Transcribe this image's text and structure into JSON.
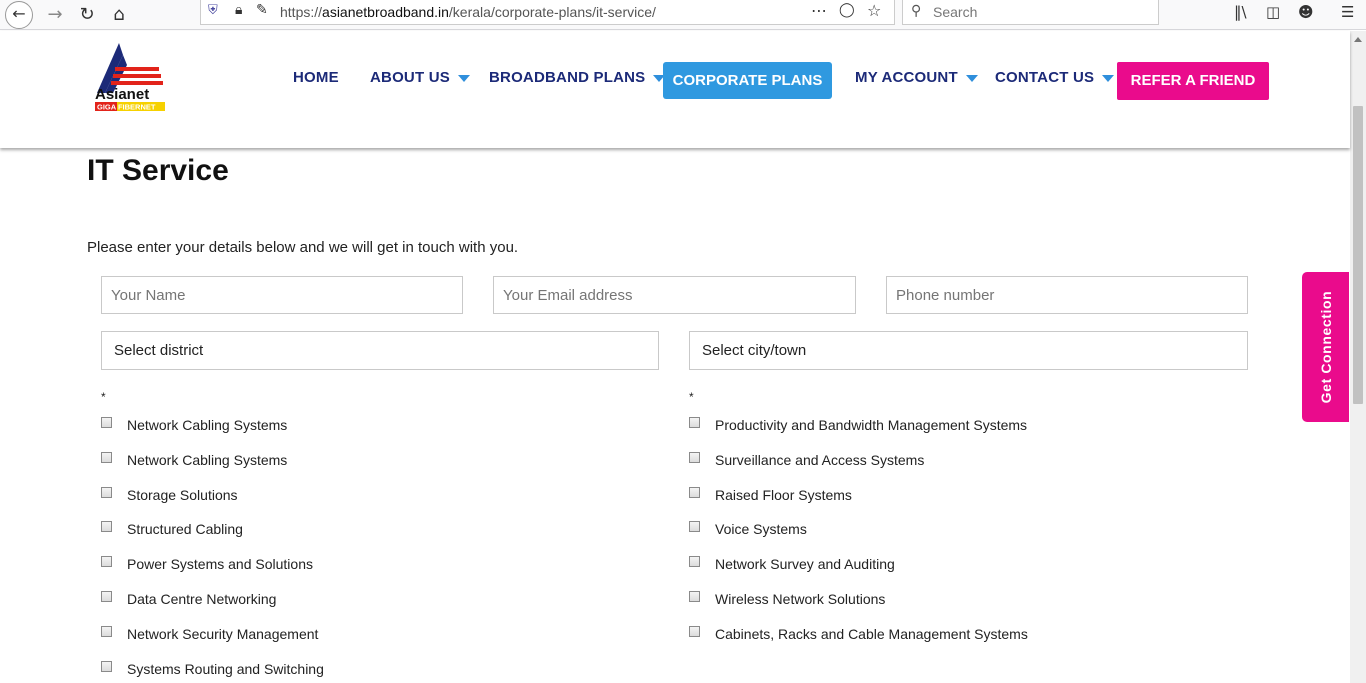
{
  "browser": {
    "url_prefix": "https://",
    "url_domain": "asianetbroadband.in",
    "url_path": "/kerala/corporate-plans/it-service/",
    "search_placeholder": "Search",
    "icons": [
      "back-icon",
      "forward-icon",
      "reload-icon",
      "home-icon",
      "shield-icon",
      "lock-icon",
      "permissions-icon",
      "more-icon",
      "pocket-icon",
      "bookmark-star-icon",
      "search-icon",
      "library-icon",
      "sidebar-icon",
      "account-icon",
      "menu-icon"
    ]
  },
  "header": {
    "logo_text": "Asianet",
    "logo_sub": "GIGA FIBERNET",
    "nav": {
      "home": "HOME",
      "about": "ABOUT US",
      "broadband": "BROADBAND PLANS",
      "corporate": "CORPORATE PLANS",
      "account": "MY ACCOUNT",
      "contact": "CONTACT US",
      "refer": "REFER A FRIEND"
    },
    "colors": {
      "nav_text": "#1c2a78",
      "active_bg": "#2f99e0",
      "accent_pink": "#ea0b8c"
    }
  },
  "page": {
    "title": "IT Service",
    "intro": "Please enter your details below and we will get in touch with you."
  },
  "form": {
    "name_placeholder": "Your Name",
    "email_placeholder": "Your Email address",
    "phone_placeholder": "Phone number",
    "district_selected": "Select district",
    "city_selected": "Select city/town",
    "required_mark": "*",
    "left_options": [
      "Network Cabling Systems",
      "Network Cabling Systems",
      "Storage Solutions",
      "Structured Cabling",
      "Power Systems and Solutions",
      "Data Centre Networking",
      "Network Security Management",
      "Systems Routing and Switching"
    ],
    "right_options": [
      "Productivity and Bandwidth Management Systems",
      "Surveillance and Access Systems",
      "Raised Floor Systems",
      "Voice Systems",
      "Network Survey and Auditing",
      "Wireless Network Solutions",
      "Cabinets, Racks and Cable Management Systems"
    ]
  },
  "floating": {
    "get_connection": "Get Connection"
  }
}
